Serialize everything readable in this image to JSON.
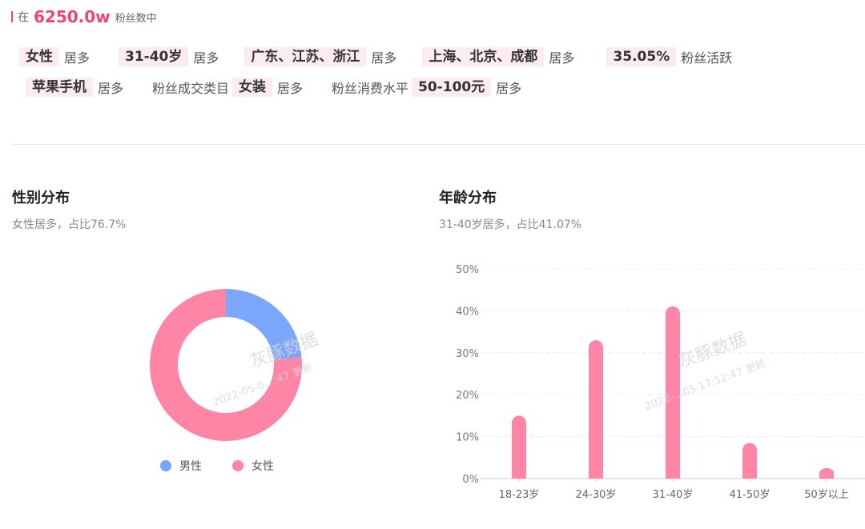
{
  "header": {
    "prefix": "在",
    "fans": "6250.0w",
    "suffix": "粉丝数中"
  },
  "tags_row1": [
    {
      "chip": "女性",
      "text": "居多"
    },
    {
      "chip": "31-40岁",
      "text": "居多"
    },
    {
      "chip": "广东、江苏、浙江",
      "text": "居多"
    },
    {
      "chip": "上海、北京、成都",
      "text": "居多"
    },
    {
      "chip": "35.05%",
      "text": "粉丝活跃"
    }
  ],
  "tags_row2": {
    "phone_chip": "苹果手机",
    "phone_text": "居多",
    "category_label": "粉丝成交类目",
    "category_chip": "女装",
    "category_text": "居多",
    "spend_label": "粉丝消费水平",
    "spend_chip": "50-100元",
    "spend_text": "居多"
  },
  "watermark": {
    "brand": "灰豚数据",
    "date_left": "2022-05-0…:47 更新",
    "date_right": "2022-…05 17:52:47 更新"
  },
  "colors": {
    "male": "#7aa7fb",
    "female": "#fe85a6",
    "accent": "#f0456e"
  },
  "chart_data": [
    {
      "type": "pie",
      "title": "性别分布",
      "subtitle": "女性居多，占比76.7%",
      "categories": [
        "男性",
        "女性"
      ],
      "values": [
        23.3,
        76.7
      ],
      "legend": "bottom"
    },
    {
      "type": "bar",
      "title": "年龄分布",
      "subtitle": "31-40岁居多，占比41.07%",
      "categories": [
        "18-23岁",
        "24-30岁",
        "31-40岁",
        "41-50岁",
        "50岁以上"
      ],
      "values": [
        15.0,
        33.0,
        41.07,
        8.5,
        2.5
      ],
      "ylim": [
        0,
        50
      ],
      "yticks": [
        "0%",
        "10%",
        "20%",
        "30%",
        "40%",
        "50%"
      ],
      "grid": true
    }
  ]
}
